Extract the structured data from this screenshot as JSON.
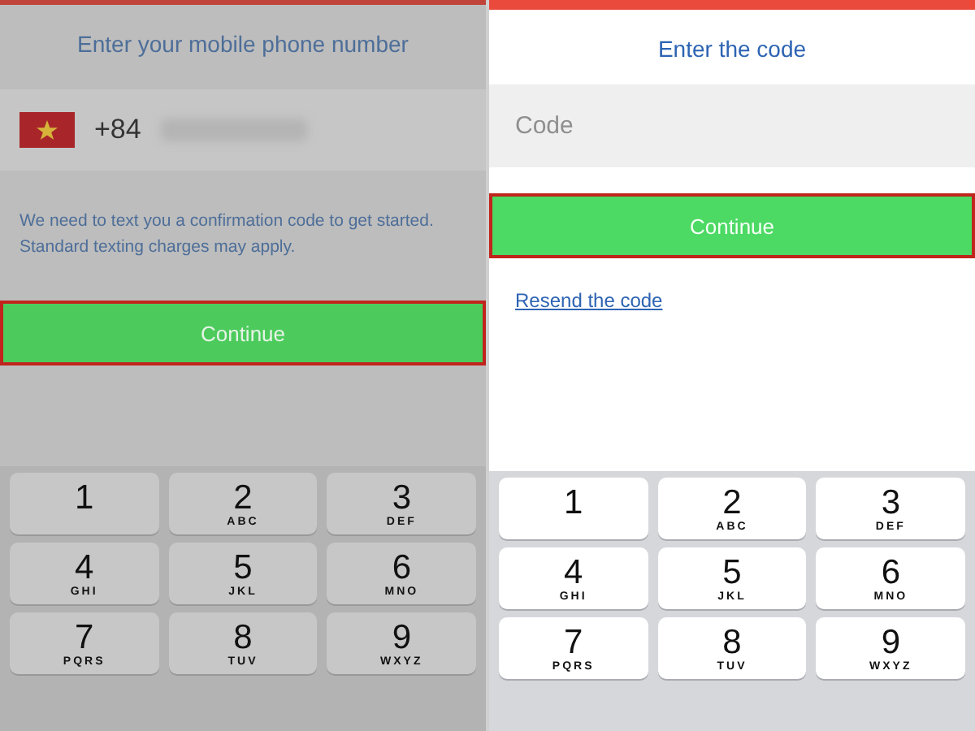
{
  "screens": [
    {
      "kind": "phone",
      "dimmed": true,
      "title": "Enter your mobile phone number",
      "country_code": "+84",
      "note": "We need to text you a confirmation code to get started. Standard texting charges may apply.",
      "button": {
        "label": "Continue",
        "highlighted": true
      },
      "keypad": [
        {
          "digit": "1"
        },
        {
          "digit": "2",
          "letters": "ABC"
        },
        {
          "digit": "3",
          "letters": "DEF"
        },
        {
          "digit": "4",
          "letters": "GHI"
        },
        {
          "digit": "5",
          "letters": "JKL"
        },
        {
          "digit": "6",
          "letters": "MNO"
        },
        {
          "digit": "7",
          "letters": "PQRS"
        },
        {
          "digit": "8",
          "letters": "TUV"
        },
        {
          "digit": "9",
          "letters": "WXYZ"
        }
      ]
    },
    {
      "kind": "code",
      "dimmed": false,
      "title": "Enter the code",
      "placeholder": "Code",
      "button": {
        "label": "Continue",
        "highlighted": true
      },
      "link": "Resend the code",
      "keypad": [
        {
          "digit": "1"
        },
        {
          "digit": "2",
          "letters": "ABC"
        },
        {
          "digit": "3",
          "letters": "DEF"
        },
        {
          "digit": "4",
          "letters": "GHI"
        },
        {
          "digit": "5",
          "letters": "JKL"
        },
        {
          "digit": "6",
          "letters": "MNO"
        },
        {
          "digit": "7",
          "letters": "PQRS"
        },
        {
          "digit": "8",
          "letters": "TUV"
        },
        {
          "digit": "9",
          "letters": "WXYZ"
        }
      ]
    }
  ]
}
